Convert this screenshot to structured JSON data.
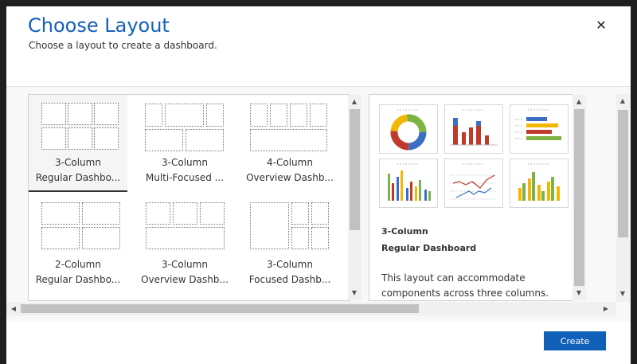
{
  "dialog": {
    "title": "Choose Layout",
    "subtitle": "Choose a layout to create a dashboard.",
    "close_glyph": "✕"
  },
  "layouts": [
    {
      "line1": "3-Column",
      "line2": "Regular Dashbo...",
      "selected": true
    },
    {
      "line1": "3-Column",
      "line2": "Multi-Focused ...",
      "selected": false
    },
    {
      "line1": "4-Column",
      "line2": "Overview Dashb...",
      "selected": false
    },
    {
      "line1": "2-Column",
      "line2": "Regular Dashbo...",
      "selected": false
    },
    {
      "line1": "3-Column",
      "line2": "Overview Dashb...",
      "selected": false
    },
    {
      "line1": "3-Column",
      "line2": "Focused Dashb...",
      "selected": false
    }
  ],
  "preview": {
    "name_line1": "3-Column",
    "name_line2": "Regular Dashboard",
    "description": "This layout can accommodate components across three columns.",
    "thumbnails": [
      "donut-chart",
      "column-chart",
      "bar-chart",
      "clustered-column-chart",
      "line-chart",
      "stacked-column-chart"
    ]
  },
  "footer": {
    "create_label": "Create"
  },
  "colors": {
    "accent": "#1160b7",
    "title": "#1560bd",
    "chart_red": "#c0392b",
    "chart_blue": "#3a6fc4",
    "chart_green": "#7cb342",
    "chart_yellow": "#f2b705"
  }
}
